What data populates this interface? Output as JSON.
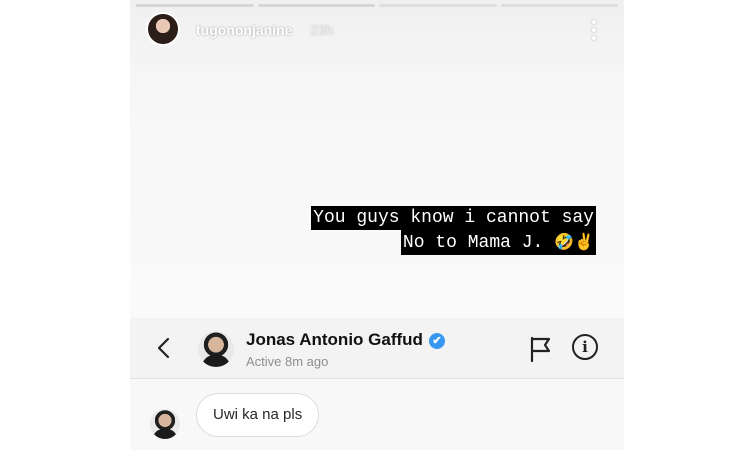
{
  "story": {
    "username": "tugononjanine",
    "time": "23h",
    "caption_line1": "You guys know i cannot say",
    "caption_line2": "No to Mama J.",
    "caption_emojis": "🤣✌️"
  },
  "reply_header": {
    "name": "Jonas Antonio Gaffud",
    "verified_icon": "✔",
    "status": "Active 8m ago",
    "info_label": "i"
  },
  "messages": [
    {
      "text": "Uwi ka na pls"
    }
  ],
  "colors": {
    "verified": "#3897f0",
    "caption_bg": "#000000"
  }
}
